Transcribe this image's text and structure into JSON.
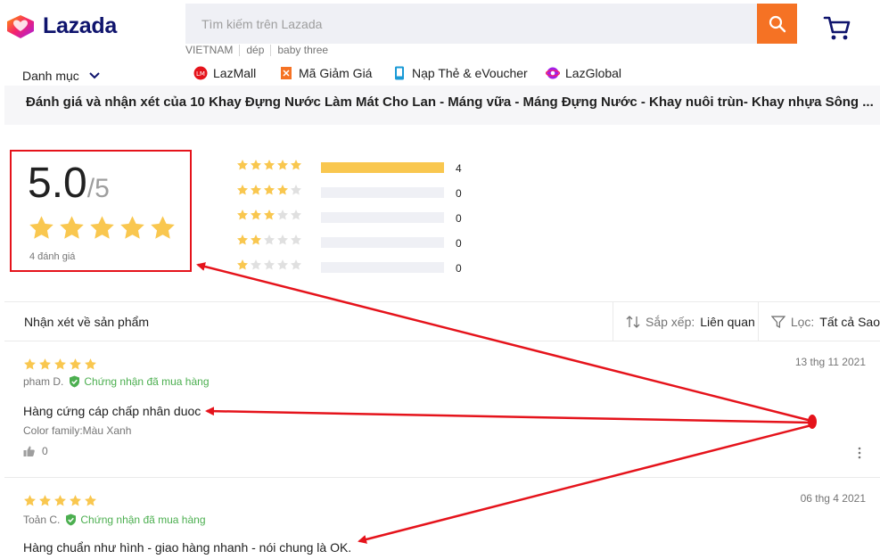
{
  "header": {
    "logo_text": "Lazada",
    "search_placeholder": "Tìm kiếm trên Lazada",
    "suggestions": [
      "VIETNAM",
      "dép",
      "baby three"
    ],
    "category_label": "Danh mục",
    "nav_links": [
      {
        "label": "LazMall",
        "icon": "lazmall-icon"
      },
      {
        "label": "Mã Giảm Giá",
        "icon": "voucher-icon"
      },
      {
        "label": "Nạp Thẻ & eVoucher",
        "icon": "phone-topup-icon"
      },
      {
        "label": "LazGlobal",
        "icon": "globe-icon"
      }
    ]
  },
  "product": {
    "review_title": "Đánh giá và nhận xét của 10 Khay Đựng Nước Làm Mát Cho Lan - Máng vữa - Máng Đựng Nước - Khay nuôi trùn- Khay nhựa Sông ..."
  },
  "summary": {
    "score": "5.0",
    "max": "/5",
    "count_label": "4 đánh giá",
    "distribution": [
      {
        "stars": 5,
        "count": "4",
        "fraction": 1.0
      },
      {
        "stars": 4,
        "count": "0",
        "fraction": 0
      },
      {
        "stars": 3,
        "count": "0",
        "fraction": 0
      },
      {
        "stars": 2,
        "count": "0",
        "fraction": 0
      },
      {
        "stars": 1,
        "count": "0",
        "fraction": 0
      }
    ]
  },
  "review_list": {
    "title": "Nhận xét về sản phẩm",
    "sort_label": "Sắp xếp:",
    "sort_value": "Liên quan",
    "filter_label": "Lọc:",
    "filter_value": "Tất cả Sao"
  },
  "reviews": [
    {
      "rating": 5,
      "date": "13 thg 11 2021",
      "author": "pham D.",
      "verified_label": "Chứng nhận đã mua hàng",
      "text": "Hàng cứng cáp chấp nhân duoc",
      "sku": "Color family:Màu Xanh",
      "likes": "0"
    },
    {
      "rating": 5,
      "date": "06 thg 4 2021",
      "author": "Toản C.",
      "verified_label": "Chứng nhận đã mua hàng",
      "text": "Hàng chuẩn như hình - giao hàng nhanh - nói chung là OK."
    }
  ],
  "colors": {
    "brand_orange": "#f57224",
    "star": "#f9c74f",
    "annotation": "#e5131b",
    "verified": "#4caf50"
  }
}
